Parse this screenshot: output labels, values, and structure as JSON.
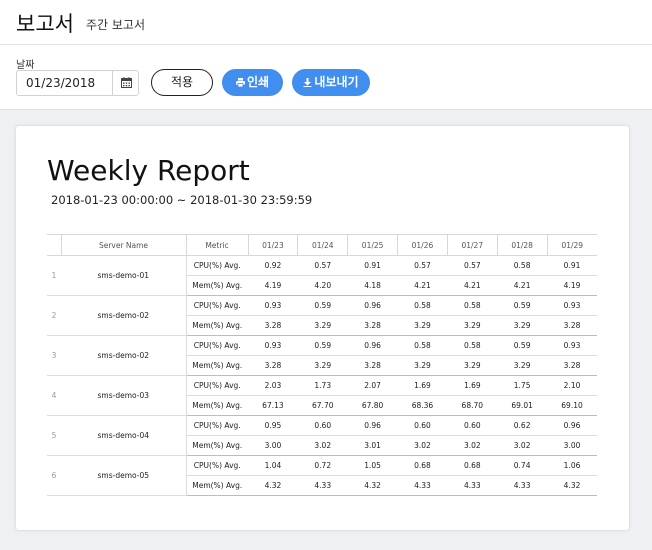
{
  "header": {
    "title": "보고서",
    "subtitle": "주간 보고서"
  },
  "filters": {
    "date_label": "날짜",
    "date_value": "01/23/2018",
    "calendar_icon": "calendar-icon",
    "apply_label": "적용",
    "print_label": "인쇄",
    "print_icon": "print-icon",
    "export_label": "내보내기",
    "export_icon": "download-icon"
  },
  "colors": {
    "accent": "#3f8ef0",
    "background": "#eef0f3"
  },
  "report": {
    "title": "Weekly Report",
    "range": "2018-01-23 00:00:00 ~ 2018-01-30 23:59:59",
    "columns": {
      "index": "",
      "server": "Server Name",
      "metric": "Metric",
      "dates": [
        "01/23",
        "01/24",
        "01/25",
        "01/26",
        "01/27",
        "01/28",
        "01/29"
      ]
    },
    "rows": [
      {
        "index": "1",
        "server": "sms-demo-01",
        "cpu": {
          "label": "CPU(%) Avg.",
          "values": [
            "0.92",
            "0.57",
            "0.91",
            "0.57",
            "0.57",
            "0.58",
            "0.91"
          ]
        },
        "mem": {
          "label": "Mem(%) Avg.",
          "values": [
            "4.19",
            "4.20",
            "4.18",
            "4.21",
            "4.21",
            "4.21",
            "4.19"
          ]
        }
      },
      {
        "index": "2",
        "server": "sms-demo-02",
        "cpu": {
          "label": "CPU(%) Avg.",
          "values": [
            "0.93",
            "0.59",
            "0.96",
            "0.58",
            "0.58",
            "0.59",
            "0.93"
          ]
        },
        "mem": {
          "label": "Mem(%) Avg.",
          "values": [
            "3.28",
            "3.29",
            "3.28",
            "3.29",
            "3.29",
            "3.29",
            "3.28"
          ]
        }
      },
      {
        "index": "3",
        "server": "sms-demo-02",
        "cpu": {
          "label": "CPU(%) Avg.",
          "values": [
            "0.93",
            "0.59",
            "0.96",
            "0.58",
            "0.58",
            "0.59",
            "0.93"
          ]
        },
        "mem": {
          "label": "Mem(%) Avg.",
          "values": [
            "3.28",
            "3.29",
            "3.28",
            "3.29",
            "3.29",
            "3.29",
            "3.28"
          ]
        }
      },
      {
        "index": "4",
        "server": "sms-demo-03",
        "cpu": {
          "label": "CPU(%) Avg.",
          "values": [
            "2.03",
            "1.73",
            "2.07",
            "1.69",
            "1.69",
            "1.75",
            "2.10"
          ]
        },
        "mem": {
          "label": "Mem(%) Avg.",
          "values": [
            "67.13",
            "67.70",
            "67.80",
            "68.36",
            "68.70",
            "69.01",
            "69.10"
          ]
        }
      },
      {
        "index": "5",
        "server": "sms-demo-04",
        "cpu": {
          "label": "CPU(%) Avg.",
          "values": [
            "0.95",
            "0.60",
            "0.96",
            "0.60",
            "0.60",
            "0.62",
            "0.96"
          ]
        },
        "mem": {
          "label": "Mem(%) Avg.",
          "values": [
            "3.00",
            "3.02",
            "3.01",
            "3.02",
            "3.02",
            "3.02",
            "3.00"
          ]
        }
      },
      {
        "index": "6",
        "server": "sms-demo-05",
        "cpu": {
          "label": "CPU(%) Avg.",
          "values": [
            "1.04",
            "0.72",
            "1.05",
            "0.68",
            "0.68",
            "0.74",
            "1.06"
          ]
        },
        "mem": {
          "label": "Mem(%) Avg.",
          "values": [
            "4.32",
            "4.33",
            "4.32",
            "4.33",
            "4.33",
            "4.33",
            "4.32"
          ]
        }
      }
    ]
  }
}
